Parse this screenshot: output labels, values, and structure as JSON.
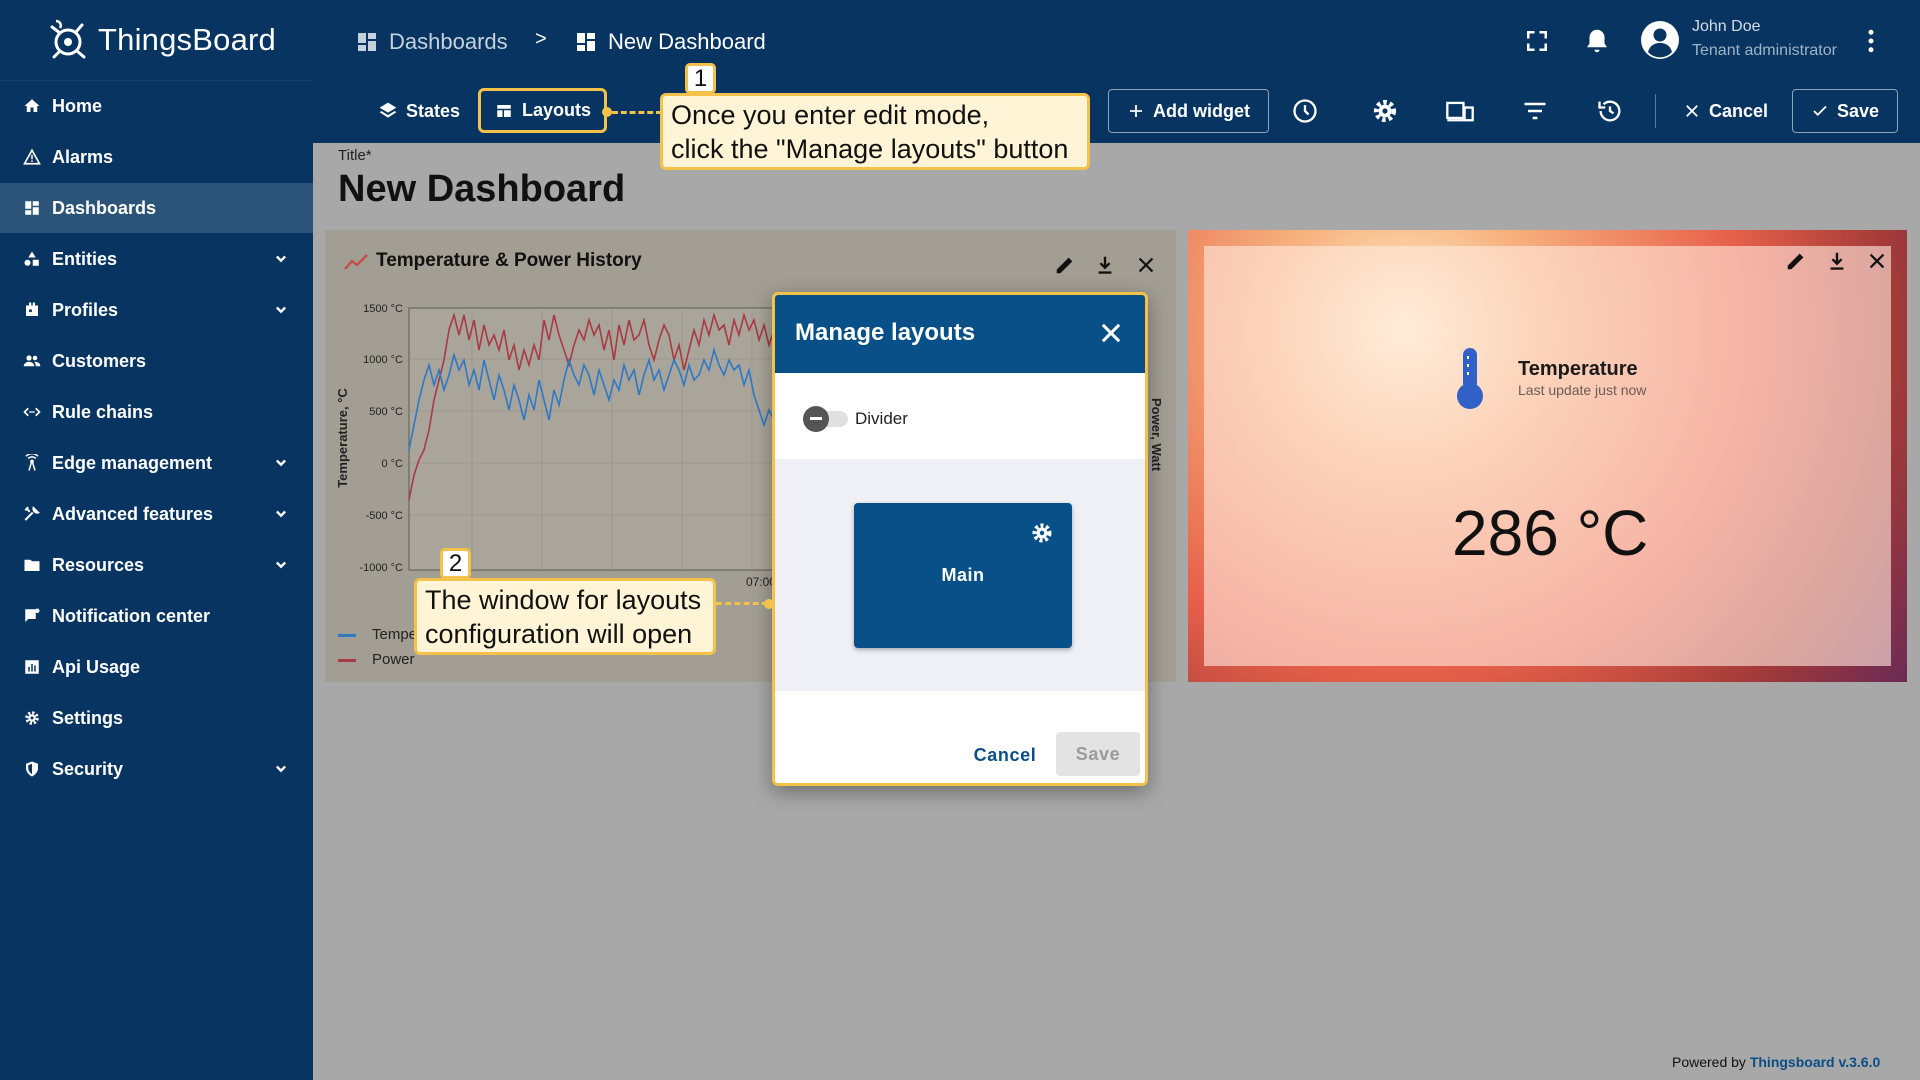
{
  "app": {
    "name": "ThingsBoard"
  },
  "breadcrumb": {
    "dashboards": "Dashboards",
    "separator": ">",
    "current": "New Dashboard"
  },
  "user": {
    "name": "John Doe",
    "role": "Tenant administrator"
  },
  "sidebar": {
    "items": [
      {
        "label": "Home",
        "icon": "home-icon"
      },
      {
        "label": "Alarms",
        "icon": "alarm-icon"
      },
      {
        "label": "Dashboards",
        "icon": "dashboards-icon",
        "active": true
      },
      {
        "label": "Entities",
        "icon": "entities-icon",
        "expandable": true
      },
      {
        "label": "Profiles",
        "icon": "profiles-icon",
        "expandable": true
      },
      {
        "label": "Customers",
        "icon": "customers-icon"
      },
      {
        "label": "Rule chains",
        "icon": "rule-chains-icon"
      },
      {
        "label": "Edge management",
        "icon": "edge-icon",
        "expandable": true
      },
      {
        "label": "Advanced features",
        "icon": "advanced-icon",
        "expandable": true
      },
      {
        "label": "Resources",
        "icon": "folder-icon",
        "expandable": true
      },
      {
        "label": "Notification center",
        "icon": "notification-icon"
      },
      {
        "label": "Api Usage",
        "icon": "api-usage-icon"
      },
      {
        "label": "Settings",
        "icon": "gear-icon"
      },
      {
        "label": "Security",
        "icon": "shield-icon",
        "expandable": true
      }
    ]
  },
  "toolbar": {
    "states": "States",
    "layouts": "Layouts",
    "add_widget": "Add widget",
    "cancel": "Cancel",
    "save": "Save"
  },
  "dashboard": {
    "title_label": "Title*",
    "title": "New Dashboard"
  },
  "chart_widget": {
    "title": "Temperature & Power History",
    "y_axis_label": "Temperature, °C",
    "y_axis_right_label": "Power, Watt",
    "y_ticks": [
      "1500 °C",
      "1000 °C",
      "500 °C",
      "0 °C",
      "-500 °C",
      "-1000 °C"
    ],
    "x_tick_visible": "07:00",
    "legend": [
      "Tempe",
      "Power"
    ],
    "colors": {
      "temperature": "#2f78c4",
      "power": "#a83a44"
    }
  },
  "temp_widget": {
    "title": "Temperature",
    "subtitle": "Last update just now",
    "value": "286 °C"
  },
  "dialog": {
    "title": "Manage layouts",
    "divider_label": "Divider",
    "divider_enabled": false,
    "layout_card_label": "Main",
    "cancel": "Cancel",
    "save": "Save"
  },
  "callouts": {
    "one": {
      "number": "1",
      "line1": "Once you enter edit mode,",
      "line2": "click the \"Manage layouts\" button"
    },
    "two": {
      "number": "2",
      "line1": "The window for layouts",
      "line2": "configuration will open"
    }
  },
  "footer": {
    "prefix": "Powered by ",
    "link": "Thingsboard v.3.6.0"
  },
  "colors": {
    "primary": "#073460",
    "accent": "#f4c24a",
    "dialog_header": "#085087"
  }
}
